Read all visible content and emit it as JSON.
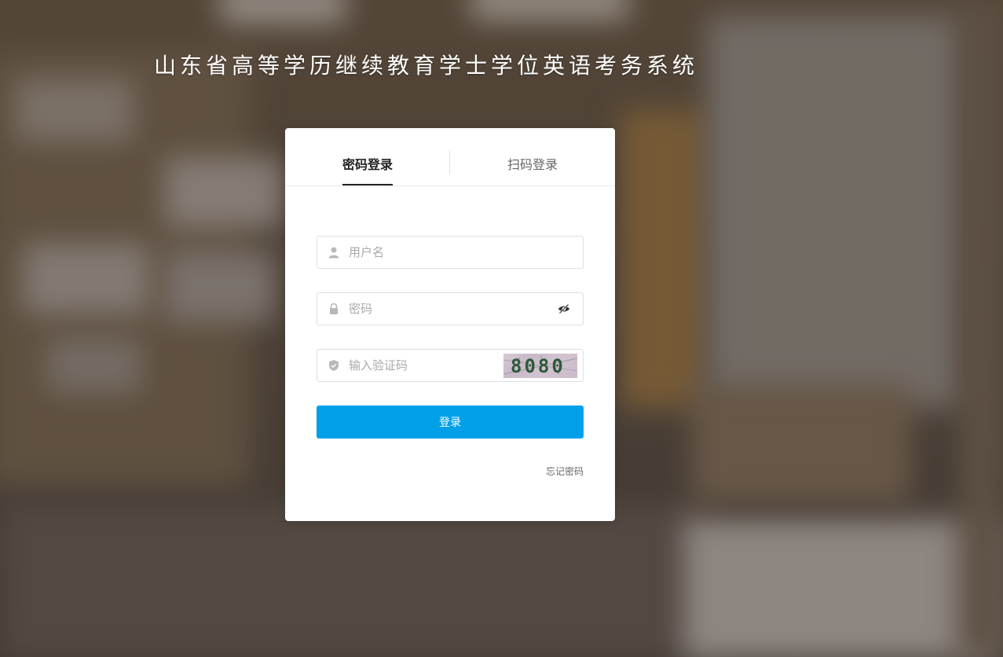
{
  "page": {
    "title": "山东省高等学历继续教育学士学位英语考务系统"
  },
  "login": {
    "tabs": [
      {
        "label": "密码登录",
        "active": true
      },
      {
        "label": "扫码登录",
        "active": false
      }
    ],
    "username": {
      "value": "",
      "placeholder": "用户名"
    },
    "password": {
      "value": "",
      "placeholder": "密码"
    },
    "captcha": {
      "value": "",
      "placeholder": "输入验证码",
      "image_text": "8080"
    },
    "submit_label": "登录",
    "forgot_label": "忘记密码"
  },
  "icons": {
    "username": "user-icon",
    "password": "lock-icon",
    "captcha": "shield-icon",
    "toggle": "eye-slash-icon"
  },
  "colors": {
    "accent": "#00a0e9",
    "active_tab": "#222222"
  }
}
